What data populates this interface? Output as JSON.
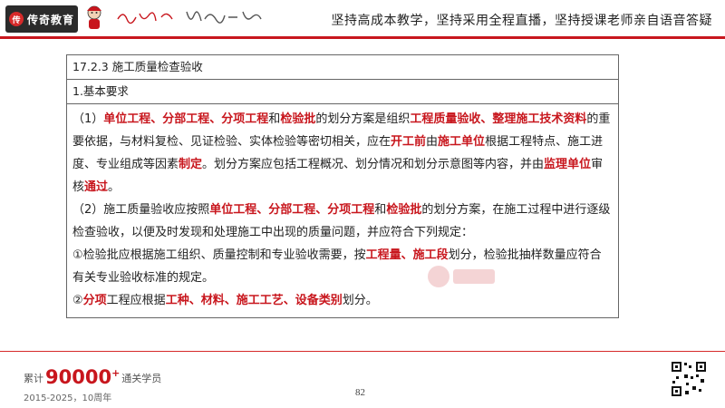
{
  "header": {
    "logo_text": "传奇教育",
    "logo_mark": "传",
    "slogan": "坚持高成本教学，坚持采用全程直播，坚持授课老师亲自语音答疑"
  },
  "section": {
    "title": "17.2.3 施工质量检查验收",
    "subtitle": "1.基本要求"
  },
  "paragraphs": [
    {
      "segments": [
        {
          "t": "（1）",
          "h": false
        },
        {
          "t": "单位工程、分部工程、分项工程",
          "h": true
        },
        {
          "t": "和",
          "h": false
        },
        {
          "t": "检验批",
          "h": true
        },
        {
          "t": "的划分方案是组织",
          "h": false
        },
        {
          "t": "工程质量验收、整理施工技术资料",
          "h": true
        },
        {
          "t": "的重要依据，与材料复检、见证检验、实体检验等密切相关，应在",
          "h": false
        },
        {
          "t": "开工前",
          "h": true
        },
        {
          "t": "由",
          "h": false
        },
        {
          "t": "施工单位",
          "h": true
        },
        {
          "t": "根据工程特点、施工进度、专业组成等因素",
          "h": false
        },
        {
          "t": "制定",
          "h": true
        },
        {
          "t": "。划分方案应包括工程概况、划分情况和划分示意图等内容，并由",
          "h": false
        },
        {
          "t": "监理单位",
          "h": true
        },
        {
          "t": "审核",
          "h": false
        },
        {
          "t": "通过",
          "h": true
        },
        {
          "t": "。",
          "h": false
        }
      ]
    },
    {
      "segments": [
        {
          "t": "（2）施工质量验收应按照",
          "h": false
        },
        {
          "t": "单位工程、分部工程、分项工程",
          "h": true
        },
        {
          "t": "和",
          "h": false
        },
        {
          "t": "检验批",
          "h": true
        },
        {
          "t": "的划分方案，在施工过程中进行逐级检查验收，以便及时发现和处理施工中出现的质量问题，并应符合下列规定：",
          "h": false
        }
      ]
    },
    {
      "segments": [
        {
          "t": "①检验批应根据施工组织、质量控制和专业验收需要，按",
          "h": false
        },
        {
          "t": "工程量、施工段",
          "h": true
        },
        {
          "t": "划分，检验批抽样数量应符合有关专业验收标准的规定。",
          "h": false
        }
      ]
    },
    {
      "segments": [
        {
          "t": "②",
          "h": false
        },
        {
          "t": "分项",
          "h": true
        },
        {
          "t": "工程应根据",
          "h": false
        },
        {
          "t": "工种、材料、施工工艺、设备类别",
          "h": true
        },
        {
          "t": "划分。",
          "h": false
        }
      ]
    }
  ],
  "footer": {
    "prefix": "累计",
    "number": "90000",
    "plus": "+",
    "suffix": "通关学员",
    "years": "2015-2025，10周年",
    "page": "82"
  },
  "icons": [
    "logo-mark-icon",
    "mascot-icon",
    "handwritten-slogan-icon",
    "watermark-logo-icon",
    "qr-code-icon"
  ],
  "colors": {
    "accent": "#c8161d",
    "logo_bg": "#2b2b2b"
  }
}
